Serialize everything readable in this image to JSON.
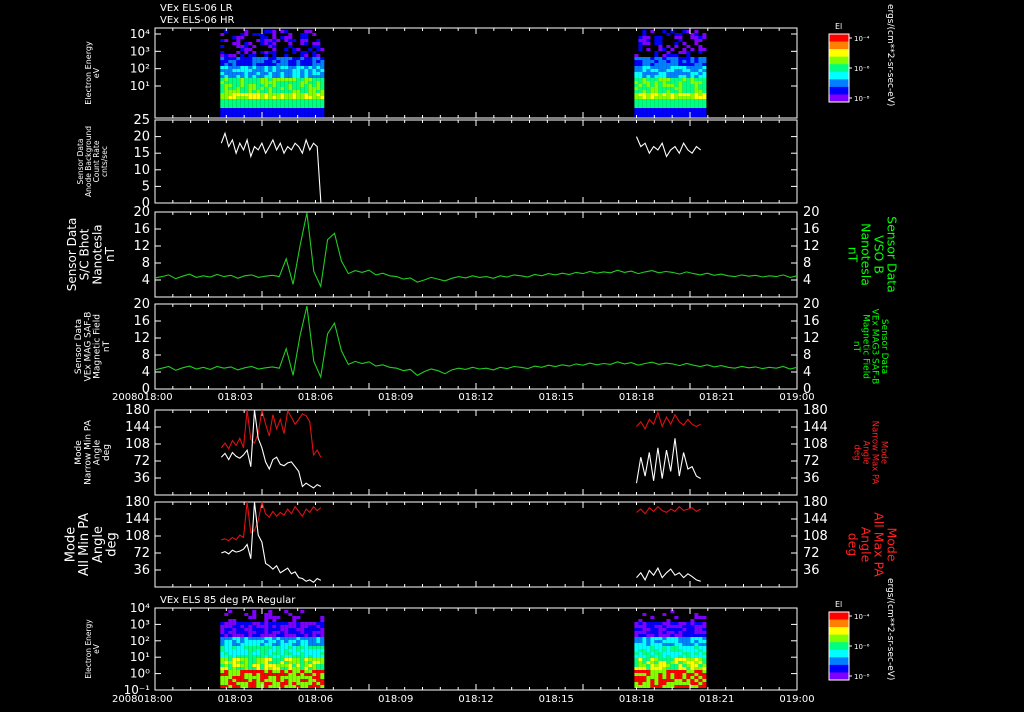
{
  "header": {
    "line1": "VEx ELS-06 LR",
    "line2": "VEx ELS-06 HR"
  },
  "panel7_header": "VEx ELS 85 deg PA Regular",
  "year_label": "2008",
  "x_tick_labels": [
    "018:00",
    "018:03",
    "018:06",
    "018:09",
    "018:12",
    "018:15",
    "018:18",
    "018:21",
    "019:00"
  ],
  "colorbar": {
    "title": "El",
    "unit": "ergs/(cm**2-sr-sec-eV)",
    "tick_labels": [
      "10⁻⁴",
      "10⁻⁶",
      "10⁻⁸"
    ],
    "colors": [
      "#ff0000",
      "#ff8000",
      "#ffff00",
      "#80ff00",
      "#00ff80",
      "#00ffff",
      "#0080ff",
      "#0000ff",
      "#8000ff"
    ]
  },
  "colors": {
    "white": "#ffffff",
    "green": "#22cc22",
    "red": "#e01010",
    "green_label": "#00ff00",
    "red_label": "#ff2020"
  },
  "chart_data": [
    {
      "id": "p1",
      "type": "heatmap",
      "ylabel": [
        "Electron Energy",
        "eV"
      ],
      "y_scale": "log",
      "y_tick_labels": [
        "10⁴",
        "10³",
        "10²",
        "10¹"
      ],
      "x": "time (hours from 018:00)",
      "data_blocks": [
        [
          0.61,
          1.55
        ],
        [
          4.48,
          5.15
        ]
      ]
    },
    {
      "id": "p2",
      "type": "line",
      "ylabel": [
        "Sensor Data",
        "Anode Background",
        "Count Rate",
        "cnts/sec"
      ],
      "ylim": [
        0,
        25
      ],
      "y_tick_labels": [
        "25",
        "20",
        "15",
        "10",
        "5",
        "0"
      ],
      "series": [
        {
          "color": "white",
          "segments": [
            {
              "x0": 0.62,
              "x1": 1.55,
              "values": [
                18,
                21,
                17,
                19,
                15,
                18,
                16,
                19,
                14,
                17,
                16,
                18,
                15,
                17,
                19,
                16,
                18,
                15,
                17,
                16,
                18,
                17,
                15,
                19,
                16,
                18,
                17,
                0
              ]
            },
            {
              "x0": 4.5,
              "x1": 5.1,
              "values": [
                20,
                17,
                18,
                15,
                17,
                16,
                18,
                14,
                16,
                17,
                15,
                18,
                16,
                15,
                17,
                16
              ]
            }
          ]
        }
      ]
    },
    {
      "id": "p3",
      "type": "line",
      "ylabel": [
        "Sensor Data",
        "S/C Bhot",
        "Nanotesla",
        "nT"
      ],
      "ylabel_right": [
        "Sensor Data",
        "VSO B",
        "Nanotesla",
        "nT"
      ],
      "ylim": [
        0,
        20
      ],
      "y_tick_labels": [
        "20",
        "16",
        "12",
        "8",
        "4"
      ],
      "series": [
        {
          "color": "green",
          "x0": 0,
          "x1": 6,
          "values": [
            4.5,
            4.8,
            5.2,
            4.3,
            4.9,
            5.4,
            4.6,
            5.0,
            4.7,
            5.3,
            4.8,
            5.1,
            4.4,
            5.0,
            5.2,
            4.6,
            4.9,
            5.1,
            4.8,
            9.0,
            3.0,
            12.0,
            19.8,
            6.0,
            2.5,
            13.5,
            15.0,
            8.5,
            5.5,
            6.2,
            5.8,
            6.3,
            5.2,
            5.6,
            5.0,
            4.8,
            4.2,
            4.5,
            3.5,
            4.0,
            4.6,
            4.2,
            3.8,
            4.4,
            4.8,
            4.5,
            5.0,
            4.6,
            4.8,
            4.4,
            5.0,
            4.7,
            5.2,
            5.0,
            4.7,
            5.3,
            5.0,
            5.5,
            5.2,
            5.6,
            5.3,
            5.8,
            5.5,
            6.0,
            5.6,
            5.9,
            5.7,
            6.3,
            5.8,
            6.1,
            5.5,
            5.9,
            6.2,
            5.7,
            6.0,
            5.8,
            5.4,
            5.9,
            5.5,
            5.2,
            5.6,
            5.1,
            5.4,
            5.0,
            4.8,
            5.2,
            4.9,
            5.1,
            4.7,
            5.0,
            4.8,
            5.2,
            4.6,
            5.0
          ]
        }
      ]
    },
    {
      "id": "p4",
      "type": "line",
      "ylabel": [
        "Sensor Data",
        "VEx MAG SAF-B",
        "Magnetic Field",
        "nT"
      ],
      "ylabel_right": [
        "Sensor Data",
        "VEx MAG3 SAF-B",
        "Magnetic Field",
        "nT"
      ],
      "ylim": [
        0,
        20
      ],
      "y_tick_labels": [
        "20",
        "16",
        "12",
        "8",
        "4",
        "0"
      ],
      "series": [
        {
          "color": "green",
          "x0": 0,
          "x1": 6,
          "values": [
            4.5,
            4.9,
            5.3,
            4.4,
            5.0,
            5.4,
            4.7,
            5.1,
            4.6,
            5.3,
            4.9,
            5.2,
            4.5,
            5.0,
            5.3,
            4.7,
            5.0,
            5.2,
            4.9,
            9.5,
            3.2,
            12.5,
            19.5,
            6.5,
            2.8,
            13.0,
            15.5,
            9.0,
            5.8,
            6.5,
            6.0,
            6.4,
            5.4,
            5.7,
            5.1,
            4.9,
            4.3,
            4.6,
            3.2,
            4.1,
            4.7,
            4.3,
            3.6,
            4.5,
            4.9,
            4.6,
            5.1,
            4.7,
            4.9,
            4.5,
            5.1,
            4.8,
            5.3,
            5.1,
            4.8,
            5.4,
            5.1,
            5.6,
            5.3,
            5.7,
            5.4,
            5.9,
            5.6,
            6.1,
            5.7,
            6.0,
            5.8,
            6.4,
            5.9,
            6.2,
            5.6,
            6.0,
            6.3,
            5.8,
            6.1,
            5.9,
            5.5,
            6.0,
            5.6,
            5.3,
            5.7,
            5.2,
            5.5,
            5.1,
            4.9,
            5.3,
            5.0,
            5.2,
            4.8,
            5.1,
            4.9,
            5.3,
            4.7,
            5.1
          ]
        }
      ]
    },
    {
      "id": "p5",
      "type": "line",
      "ylabel": [
        "Mode",
        "Narrow Min PA",
        "Angle",
        "deg"
      ],
      "ylabel_right": [
        "Mode",
        "Narrow Max PA",
        "Angle",
        "deg"
      ],
      "ylim": [
        0,
        180
      ],
      "y_tick_labels": [
        "180",
        "144",
        "108",
        "72",
        "36"
      ],
      "series": [
        {
          "name": "Narrow Max PA",
          "color": "red",
          "segments": [
            {
              "x0": 0.62,
              "x1": 1.55,
              "values": [
                100,
                110,
                98,
                115,
                105,
                120,
                100,
                180,
                118,
                110,
                130,
                180,
                150,
                125,
                170,
                140,
                160,
                130,
                178,
                165,
                150,
                160,
                172,
                168,
                155,
                85,
                95,
                80
              ]
            },
            {
              "x0": 4.5,
              "x1": 5.1,
              "values": [
                145,
                155,
                140,
                160,
                150,
                175,
                145,
                165,
                150,
                170,
                155,
                148,
                160,
                150,
                145,
                150
              ]
            }
          ]
        },
        {
          "name": "Narrow Min PA",
          "color": "white",
          "segments": [
            {
              "x0": 0.62,
              "x1": 1.55,
              "values": [
                80,
                88,
                75,
                90,
                82,
                78,
                85,
                95,
                60,
                180,
                120,
                100,
                70,
                55,
                75,
                80,
                65,
                62,
                68,
                70,
                60,
                50,
                18,
                25,
                20,
                15,
                22,
                18
              ]
            },
            {
              "x0": 4.5,
              "x1": 5.1,
              "values": [
                25,
                80,
                40,
                90,
                30,
                100,
                35,
                95,
                50,
                120,
                40,
                90,
                55,
                60,
                40,
                35
              ]
            }
          ]
        }
      ]
    },
    {
      "id": "p6",
      "type": "line",
      "ylabel": [
        "Mode",
        "All Min PA",
        "Angle",
        "deg"
      ],
      "ylabel_right": [
        "Mode",
        "All Max PA",
        "Angle",
        "deg"
      ],
      "ylim": [
        0,
        180
      ],
      "y_tick_labels": [
        "180",
        "144",
        "108",
        "72",
        "36"
      ],
      "series": [
        {
          "name": "All Max PA",
          "color": "red",
          "segments": [
            {
              "x0": 0.62,
              "x1": 1.55,
              "values": [
                100,
                102,
                98,
                105,
                100,
                110,
                105,
                180,
                115,
                120,
                140,
                180,
                155,
                148,
                160,
                150,
                158,
                152,
                165,
                155,
                170,
                160,
                150,
                165,
                158,
                170,
                162,
                168
              ]
            },
            {
              "x0": 4.5,
              "x1": 5.1,
              "values": [
                158,
                165,
                155,
                168,
                160,
                170,
                162,
                158,
                165,
                160,
                170,
                162,
                165,
                168,
                160,
                165
              ]
            }
          ]
        },
        {
          "name": "All Min PA",
          "color": "white",
          "segments": [
            {
              "x0": 0.62,
              "x1": 1.55,
              "values": [
                72,
                75,
                70,
                78,
                74,
                76,
                80,
                90,
                60,
                180,
                110,
                95,
                50,
                45,
                38,
                45,
                30,
                35,
                40,
                28,
                32,
                20,
                18,
                12,
                15,
                10,
                18,
                14
              ]
            },
            {
              "x0": 4.5,
              "x1": 5.1,
              "values": [
                20,
                30,
                15,
                35,
                25,
                40,
                20,
                30,
                38,
                25,
                30,
                20,
                28,
                22,
                15,
                12
              ]
            }
          ]
        }
      ]
    },
    {
      "id": "p7",
      "type": "heatmap",
      "ylabel": [
        "Electron Energy",
        "eV"
      ],
      "y_scale": "log",
      "y_tick_labels": [
        "10⁴",
        "10³",
        "10²",
        "10¹",
        "10⁰",
        "10⁻¹"
      ],
      "data_blocks": [
        [
          0.61,
          1.55
        ],
        [
          4.48,
          5.15
        ]
      ]
    }
  ]
}
